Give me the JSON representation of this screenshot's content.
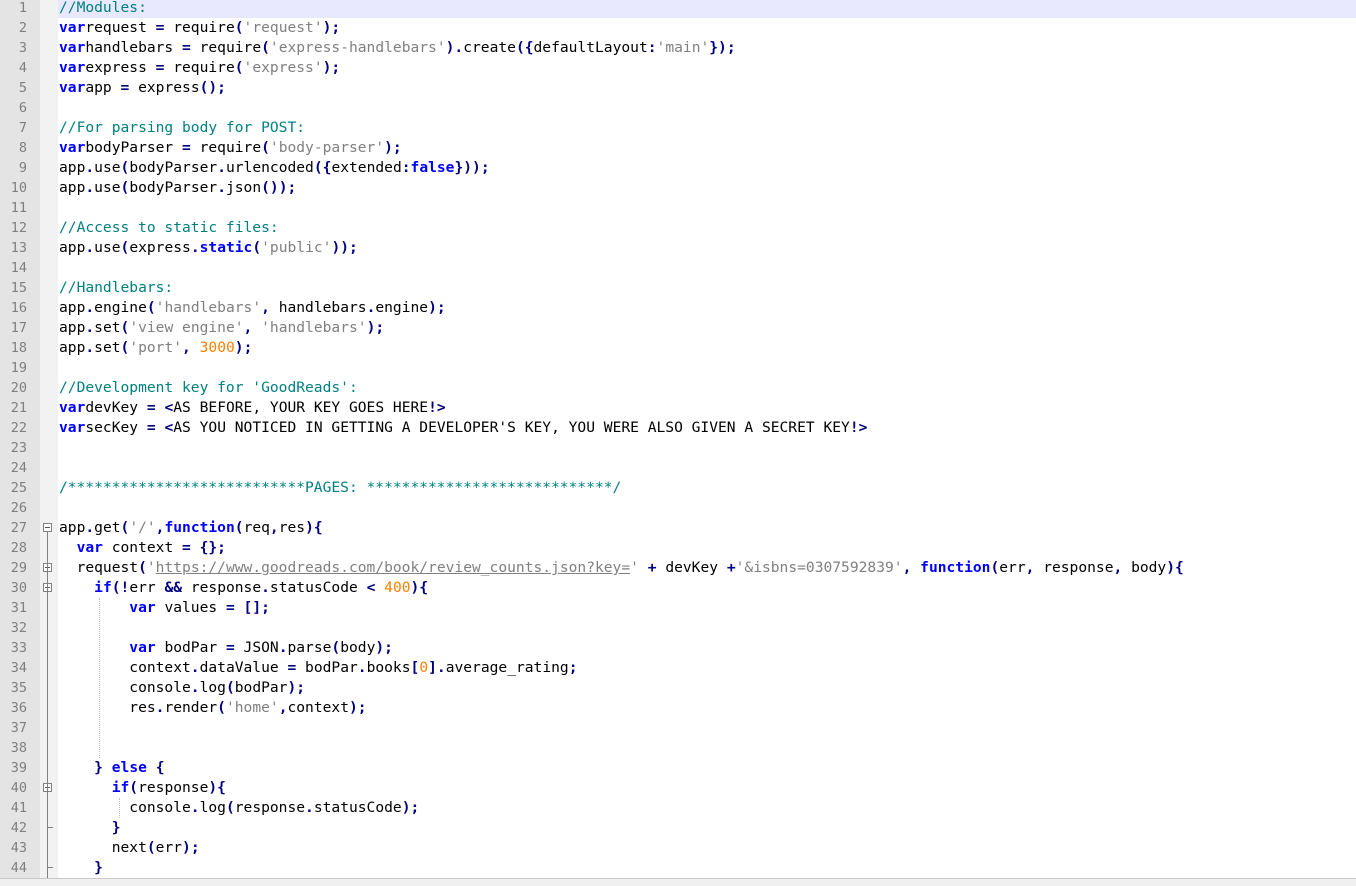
{
  "editor": {
    "current_line": 1,
    "lines": [
      {
        "n": "1",
        "tokens": [
          [
            "cm",
            "//Modules:"
          ]
        ]
      },
      {
        "n": "2",
        "tokens": [
          [
            "kw",
            "var"
          ],
          [
            "",
            "request "
          ],
          [
            "op",
            "="
          ],
          [
            "",
            " require"
          ],
          [
            "op",
            "("
          ],
          [
            "str",
            "'request'"
          ],
          [
            "op",
            ");"
          ]
        ]
      },
      {
        "n": "3",
        "tokens": [
          [
            "kw",
            "var"
          ],
          [
            "",
            "handlebars "
          ],
          [
            "op",
            "="
          ],
          [
            "",
            " require"
          ],
          [
            "op",
            "("
          ],
          [
            "str",
            "'express-handlebars'"
          ],
          [
            "op",
            ")."
          ],
          [
            "",
            "create"
          ],
          [
            "op",
            "({"
          ],
          [
            "",
            "defaultLayout"
          ],
          [
            "op",
            ":"
          ],
          [
            "str",
            "'main'"
          ],
          [
            "op",
            "});"
          ]
        ]
      },
      {
        "n": "4",
        "tokens": [
          [
            "kw",
            "var"
          ],
          [
            "",
            "express "
          ],
          [
            "op",
            "="
          ],
          [
            "",
            " require"
          ],
          [
            "op",
            "("
          ],
          [
            "str",
            "'express'"
          ],
          [
            "op",
            ");"
          ]
        ]
      },
      {
        "n": "5",
        "tokens": [
          [
            "kw",
            "var"
          ],
          [
            "",
            "app "
          ],
          [
            "op",
            "="
          ],
          [
            "",
            " express"
          ],
          [
            "op",
            "();"
          ]
        ]
      },
      {
        "n": "6",
        "tokens": []
      },
      {
        "n": "7",
        "tokens": [
          [
            "cm",
            "//For parsing body for POST:"
          ]
        ]
      },
      {
        "n": "8",
        "tokens": [
          [
            "kw",
            "var"
          ],
          [
            "",
            "bodyParser "
          ],
          [
            "op",
            "="
          ],
          [
            "",
            " require"
          ],
          [
            "op",
            "("
          ],
          [
            "str",
            "'body-parser'"
          ],
          [
            "op",
            ");"
          ]
        ]
      },
      {
        "n": "9",
        "tokens": [
          [
            "",
            "app"
          ],
          [
            "op",
            "."
          ],
          [
            "",
            "use"
          ],
          [
            "op",
            "("
          ],
          [
            "",
            "bodyParser"
          ],
          [
            "op",
            "."
          ],
          [
            "",
            "urlencoded"
          ],
          [
            "op",
            "({"
          ],
          [
            "",
            "extended"
          ],
          [
            "op",
            ":"
          ],
          [
            "kw",
            "false"
          ],
          [
            "op",
            "}));"
          ]
        ]
      },
      {
        "n": "10",
        "tokens": [
          [
            "",
            "app"
          ],
          [
            "op",
            "."
          ],
          [
            "",
            "use"
          ],
          [
            "op",
            "("
          ],
          [
            "",
            "bodyParser"
          ],
          [
            "op",
            "."
          ],
          [
            "",
            "json"
          ],
          [
            "op",
            "());"
          ]
        ]
      },
      {
        "n": "11",
        "tokens": []
      },
      {
        "n": "12",
        "tokens": [
          [
            "cm",
            "//Access to static files:"
          ]
        ]
      },
      {
        "n": "13",
        "tokens": [
          [
            "",
            "app"
          ],
          [
            "op",
            "."
          ],
          [
            "",
            "use"
          ],
          [
            "op",
            "("
          ],
          [
            "",
            "express"
          ],
          [
            "op",
            "."
          ],
          [
            "kw",
            "static"
          ],
          [
            "op",
            "("
          ],
          [
            "str",
            "'public'"
          ],
          [
            "op",
            "));"
          ]
        ]
      },
      {
        "n": "14",
        "tokens": []
      },
      {
        "n": "15",
        "tokens": [
          [
            "cm",
            "//Handlebars:"
          ]
        ]
      },
      {
        "n": "16",
        "tokens": [
          [
            "",
            "app"
          ],
          [
            "op",
            "."
          ],
          [
            "",
            "engine"
          ],
          [
            "op",
            "("
          ],
          [
            "str",
            "'handlebars'"
          ],
          [
            "op",
            ","
          ],
          [
            "",
            " handlebars"
          ],
          [
            "op",
            "."
          ],
          [
            "",
            "engine"
          ],
          [
            "op",
            ");"
          ]
        ]
      },
      {
        "n": "17",
        "tokens": [
          [
            "",
            "app"
          ],
          [
            "op",
            "."
          ],
          [
            "",
            "set"
          ],
          [
            "op",
            "("
          ],
          [
            "str",
            "'view engine'"
          ],
          [
            "op",
            ","
          ],
          [
            "",
            " "
          ],
          [
            "str",
            "'handlebars'"
          ],
          [
            "op",
            ");"
          ]
        ]
      },
      {
        "n": "18",
        "tokens": [
          [
            "",
            "app"
          ],
          [
            "op",
            "."
          ],
          [
            "",
            "set"
          ],
          [
            "op",
            "("
          ],
          [
            "str",
            "'port'"
          ],
          [
            "op",
            ","
          ],
          [
            "",
            " "
          ],
          [
            "num",
            "3000"
          ],
          [
            "op",
            ");"
          ]
        ]
      },
      {
        "n": "19",
        "tokens": []
      },
      {
        "n": "20",
        "tokens": [
          [
            "cm",
            "//Development key for 'GoodReads':"
          ]
        ]
      },
      {
        "n": "21",
        "tokens": [
          [
            "kw",
            "var"
          ],
          [
            "",
            "devKey "
          ],
          [
            "op",
            "="
          ],
          [
            "",
            " "
          ],
          [
            "op",
            "<"
          ],
          [
            "",
            "AS BEFORE, YOUR KEY GOES HERE"
          ],
          [
            "op",
            "!>"
          ]
        ]
      },
      {
        "n": "22",
        "tokens": [
          [
            "kw",
            "var"
          ],
          [
            "",
            "secKey "
          ],
          [
            "op",
            "="
          ],
          [
            "",
            " "
          ],
          [
            "op",
            "<"
          ],
          [
            "",
            "AS YOU NOTICED IN GETTING A DEVELOPER'S KEY, YOU WERE ALSO GIVEN A SECRET KEY"
          ],
          [
            "op",
            "!>"
          ]
        ]
      },
      {
        "n": "23",
        "tokens": []
      },
      {
        "n": "24",
        "tokens": []
      },
      {
        "n": "25",
        "tokens": [
          [
            "cm",
            "/***************************PAGES: ****************************/"
          ]
        ]
      },
      {
        "n": "26",
        "tokens": []
      },
      {
        "n": "27",
        "tokens": [
          [
            "",
            "app"
          ],
          [
            "op",
            "."
          ],
          [
            "",
            "get"
          ],
          [
            "op",
            "("
          ],
          [
            "str",
            "'/'"
          ],
          [
            "op",
            ","
          ],
          [
            "kw",
            "function"
          ],
          [
            "op",
            "("
          ],
          [
            "",
            "req"
          ],
          [
            "op",
            ","
          ],
          [
            "",
            "res"
          ],
          [
            "op",
            "){"
          ]
        ]
      },
      {
        "n": "28",
        "tokens": [
          [
            "",
            "  "
          ],
          [
            "kw",
            "var"
          ],
          [
            "",
            " context "
          ],
          [
            "op",
            "="
          ],
          [
            "",
            " "
          ],
          [
            "op",
            "{};"
          ]
        ]
      },
      {
        "n": "29",
        "tokens": [
          [
            "",
            "  request"
          ],
          [
            "op",
            "("
          ],
          [
            "str",
            "'"
          ],
          [
            "url",
            "https://www.goodreads.com/book/review_counts.json?key="
          ],
          [
            "str",
            "'"
          ],
          [
            "",
            " "
          ],
          [
            "op",
            "+"
          ],
          [
            "",
            " devKey "
          ],
          [
            "op",
            "+"
          ],
          [
            "str",
            "'&isbns=0307592839'"
          ],
          [
            "op",
            ","
          ],
          [
            "",
            " "
          ],
          [
            "kw",
            "function"
          ],
          [
            "op",
            "("
          ],
          [
            "",
            "err"
          ],
          [
            "op",
            ","
          ],
          [
            "",
            " response"
          ],
          [
            "op",
            ","
          ],
          [
            "",
            " body"
          ],
          [
            "op",
            "){"
          ]
        ]
      },
      {
        "n": "30",
        "tokens": [
          [
            "",
            "    "
          ],
          [
            "kw",
            "if"
          ],
          [
            "op",
            "(!"
          ],
          [
            "",
            "err "
          ],
          [
            "op",
            "&&"
          ],
          [
            "",
            " response"
          ],
          [
            "op",
            "."
          ],
          [
            "",
            "statusCode "
          ],
          [
            "op",
            "<"
          ],
          [
            "",
            " "
          ],
          [
            "num",
            "400"
          ],
          [
            "op",
            "){"
          ]
        ]
      },
      {
        "n": "31",
        "tokens": [
          [
            "",
            "        "
          ],
          [
            "kw",
            "var"
          ],
          [
            "",
            " values "
          ],
          [
            "op",
            "="
          ],
          [
            "",
            " "
          ],
          [
            "op",
            "[];"
          ]
        ]
      },
      {
        "n": "32",
        "tokens": []
      },
      {
        "n": "33",
        "tokens": [
          [
            "",
            "        "
          ],
          [
            "kw",
            "var"
          ],
          [
            "",
            " bodPar "
          ],
          [
            "op",
            "="
          ],
          [
            "",
            " JSON"
          ],
          [
            "op",
            "."
          ],
          [
            "",
            "parse"
          ],
          [
            "op",
            "("
          ],
          [
            "",
            "body"
          ],
          [
            "op",
            ");"
          ]
        ]
      },
      {
        "n": "34",
        "tokens": [
          [
            "",
            "        context"
          ],
          [
            "op",
            "."
          ],
          [
            "",
            "dataValue "
          ],
          [
            "op",
            "="
          ],
          [
            "",
            " bodPar"
          ],
          [
            "op",
            "."
          ],
          [
            "",
            "books"
          ],
          [
            "op",
            "["
          ],
          [
            "num",
            "0"
          ],
          [
            "op",
            "]."
          ],
          [
            "",
            "average_rating"
          ],
          [
            "op",
            ";"
          ]
        ]
      },
      {
        "n": "35",
        "tokens": [
          [
            "",
            "        console"
          ],
          [
            "op",
            "."
          ],
          [
            "",
            "log"
          ],
          [
            "op",
            "("
          ],
          [
            "",
            "bodPar"
          ],
          [
            "op",
            ");"
          ]
        ]
      },
      {
        "n": "36",
        "tokens": [
          [
            "",
            "        res"
          ],
          [
            "op",
            "."
          ],
          [
            "",
            "render"
          ],
          [
            "op",
            "("
          ],
          [
            "str",
            "'home'"
          ],
          [
            "op",
            ","
          ],
          [
            "",
            "context"
          ],
          [
            "op",
            ");"
          ]
        ]
      },
      {
        "n": "37",
        "tokens": []
      },
      {
        "n": "38",
        "tokens": []
      },
      {
        "n": "39",
        "tokens": [
          [
            "",
            "    "
          ],
          [
            "op",
            "}"
          ],
          [
            "",
            " "
          ],
          [
            "kw",
            "else"
          ],
          [
            "",
            " "
          ],
          [
            "op",
            "{"
          ]
        ]
      },
      {
        "n": "40",
        "tokens": [
          [
            "",
            "      "
          ],
          [
            "kw",
            "if"
          ],
          [
            "op",
            "("
          ],
          [
            "",
            "response"
          ],
          [
            "op",
            "){"
          ]
        ]
      },
      {
        "n": "41",
        "tokens": [
          [
            "",
            "        console"
          ],
          [
            "op",
            "."
          ],
          [
            "",
            "log"
          ],
          [
            "op",
            "("
          ],
          [
            "",
            "response"
          ],
          [
            "op",
            "."
          ],
          [
            "",
            "statusCode"
          ],
          [
            "op",
            ");"
          ]
        ]
      },
      {
        "n": "42",
        "tokens": [
          [
            "",
            "      "
          ],
          [
            "op",
            "}"
          ]
        ]
      },
      {
        "n": "43",
        "tokens": [
          [
            "",
            "      next"
          ],
          [
            "op",
            "("
          ],
          [
            "",
            "err"
          ],
          [
            "op",
            ");"
          ]
        ]
      },
      {
        "n": "44",
        "tokens": [
          [
            "",
            "    "
          ],
          [
            "op",
            "}"
          ]
        ]
      }
    ]
  }
}
